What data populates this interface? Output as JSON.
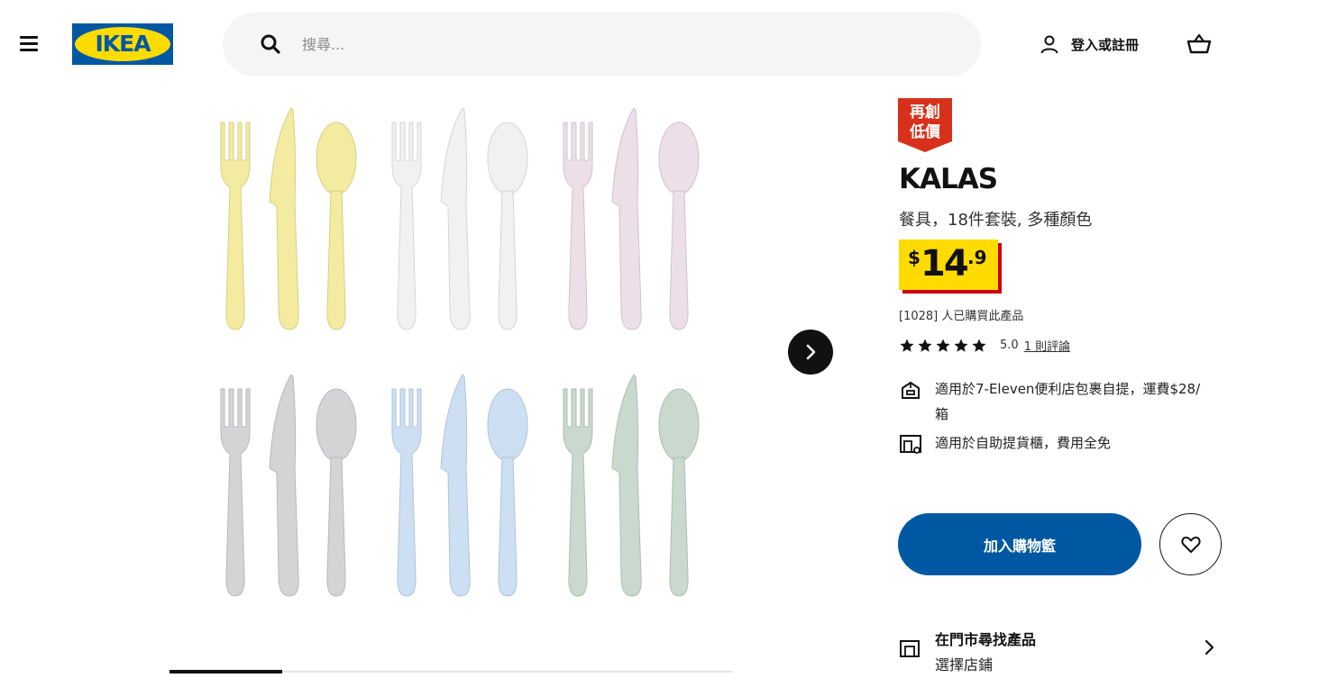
{
  "header": {
    "menu_icon": "hamburger-menu-icon",
    "logo_text": "IKEA",
    "search": {
      "placeholder": "搜尋..."
    },
    "login_label": "登入或註冊",
    "cart_icon": "shopping-basket-icon"
  },
  "product": {
    "badge_lines": [
      "再創",
      "低價"
    ],
    "name": "KALAS",
    "description": "餐具，18件套裝, 多種顏色",
    "price": {
      "currency": "$",
      "integer": "14",
      "decimal": ".9"
    },
    "purchased": "[1028] 人已購買此產品",
    "rating": {
      "stars": 5,
      "score": "5.0",
      "reviews_link": "1 則評論"
    },
    "delivery": [
      {
        "icon": "parcel-pickup-icon",
        "text": "適用於7-Eleven便利店包裹自提，運費$28/箱"
      },
      {
        "icon": "locker-pickup-icon",
        "text": "適用於自助提貨櫃，費用全免"
      }
    ],
    "add_to_cart_label": "加入購物籃",
    "favourite_icon": "heart-icon",
    "store": {
      "title": "在門市尋找產品",
      "subtitle": "選擇店鋪"
    }
  },
  "gallery": {
    "progress_fraction": 0.2,
    "sets": [
      {
        "name": "yellow",
        "color": "#f3eba0"
      },
      {
        "name": "white",
        "color": "#f1f1f1"
      },
      {
        "name": "pink",
        "color": "#ecdfe8"
      },
      {
        "name": "grey",
        "color": "#d4d4d6"
      },
      {
        "name": "blue",
        "color": "#cddff3"
      },
      {
        "name": "green",
        "color": "#c9d9cd"
      }
    ]
  },
  "colors": {
    "brand_blue": "#0058a3",
    "brand_yellow": "#ffdb00",
    "badge_red": "#d8311b",
    "price_shadow": "#cc0008"
  }
}
